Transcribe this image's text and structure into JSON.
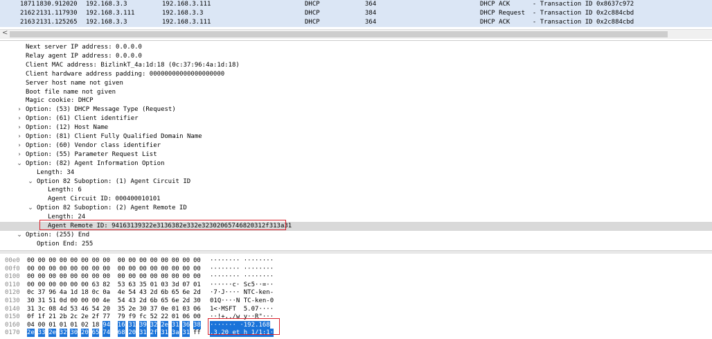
{
  "packets": [
    {
      "no": "1871",
      "time": "1830.912020",
      "src": "192.168.3.3",
      "dst": "192.168.3.111",
      "proto": "DHCP",
      "len": "364",
      "info": "DHCP ACK      - Transaction ID 0x8637c972"
    },
    {
      "no": "2162",
      "time": "2131.117930",
      "src": "192.168.3.111",
      "dst": "192.168.3.3",
      "proto": "DHCP",
      "len": "384",
      "info": "DHCP Request  - Transaction ID 0x2c884cbd"
    },
    {
      "no": "2163",
      "time": "2131.125265",
      "src": "192.168.3.3",
      "dst": "192.168.3.111",
      "proto": "DHCP",
      "len": "364",
      "info": "DHCP ACK      - Transaction ID 0x2c884cbd"
    }
  ],
  "scroll_left_arrow": "<",
  "details": [
    {
      "text": "Next server IP address: 0.0.0.0",
      "exp": ""
    },
    {
      "text": "Relay agent IP address: 0.0.0.0",
      "exp": ""
    },
    {
      "text": "Client MAC address: BizlinkT_4a:1d:18 (0c:37:96:4a:1d:18)",
      "exp": ""
    },
    {
      "text": "Client hardware address padding: 00000000000000000000",
      "exp": ""
    },
    {
      "text": "Server host name not given",
      "exp": ""
    },
    {
      "text": "Boot file name not given",
      "exp": ""
    },
    {
      "text": "Magic cookie: DHCP",
      "exp": ""
    },
    {
      "text": "Option: (53) DHCP Message Type (Request)",
      "exp": "›"
    },
    {
      "text": "Option: (61) Client identifier",
      "exp": "›"
    },
    {
      "text": "Option: (12) Host Name",
      "exp": "›"
    },
    {
      "text": "Option: (81) Client Fully Qualified Domain Name",
      "exp": "›"
    },
    {
      "text": "Option: (60) Vendor class identifier",
      "exp": "›"
    },
    {
      "text": "Option: (55) Parameter Request List",
      "exp": "›"
    },
    {
      "text": "Option: (82) Agent Information Option",
      "exp": "⌄"
    },
    {
      "text": "Length: 34",
      "exp": ""
    },
    {
      "text": "Option 82 Suboption: (1) Agent Circuit ID",
      "exp": "⌄"
    },
    {
      "text": "Length: 6",
      "exp": ""
    },
    {
      "text": "Agent Circuit ID: 000400010101",
      "exp": ""
    },
    {
      "text": "Option 82 Suboption: (2) Agent Remote ID",
      "exp": "⌄"
    },
    {
      "text": "Length: 24",
      "exp": ""
    },
    {
      "text": "Agent Remote ID: 94163139322e3136382e332e32302065746820312f313a31",
      "exp": ""
    },
    {
      "text": "Option: (255) End",
      "exp": "⌄"
    },
    {
      "text": "Option End: 255",
      "exp": ""
    }
  ],
  "hex": [
    {
      "off": "00e0",
      "bytes": [
        "00",
        "00",
        "00",
        "00",
        "00",
        "00",
        "00",
        "00",
        "00",
        "00",
        "00",
        "00",
        "00",
        "00",
        "00",
        "00"
      ],
      "ascii": "········ ········"
    },
    {
      "off": "00f0",
      "bytes": [
        "00",
        "00",
        "00",
        "00",
        "00",
        "00",
        "00",
        "00",
        "00",
        "00",
        "00",
        "00",
        "00",
        "00",
        "00",
        "00"
      ],
      "ascii": "········ ········"
    },
    {
      "off": "0100",
      "bytes": [
        "00",
        "00",
        "00",
        "00",
        "00",
        "00",
        "00",
        "00",
        "00",
        "00",
        "00",
        "00",
        "00",
        "00",
        "00",
        "00"
      ],
      "ascii": "········ ········"
    },
    {
      "off": "0110",
      "bytes": [
        "00",
        "00",
        "00",
        "00",
        "00",
        "00",
        "63",
        "82",
        "53",
        "63",
        "35",
        "01",
        "03",
        "3d",
        "07",
        "01"
      ],
      "ascii": "······c· Sc5··=··"
    },
    {
      "off": "0120",
      "bytes": [
        "0c",
        "37",
        "96",
        "4a",
        "1d",
        "18",
        "0c",
        "0a",
        "4e",
        "54",
        "43",
        "2d",
        "6b",
        "65",
        "6e",
        "2d"
      ],
      "ascii": "·7·J···· NTC-ken-"
    },
    {
      "off": "0130",
      "bytes": [
        "30",
        "31",
        "51",
        "0d",
        "00",
        "00",
        "00",
        "4e",
        "54",
        "43",
        "2d",
        "6b",
        "65",
        "6e",
        "2d",
        "30"
      ],
      "ascii": "01Q····N TC-ken-0"
    },
    {
      "off": "0140",
      "bytes": [
        "31",
        "3c",
        "08",
        "4d",
        "53",
        "46",
        "54",
        "20",
        "35",
        "2e",
        "30",
        "37",
        "0e",
        "01",
        "03",
        "06"
      ],
      "ascii": "1<·MSFT  5.07····"
    },
    {
      "off": "0150",
      "bytes": [
        "0f",
        "1f",
        "21",
        "2b",
        "2c",
        "2e",
        "2f",
        "77",
        "79",
        "f9",
        "fc",
        "52",
        "22",
        "01",
        "06",
        "00"
      ],
      "ascii": "··!+,./w y··R\"···"
    },
    {
      "off": "0160",
      "bytes": [
        "04",
        "00",
        "01",
        "01",
        "01",
        "02",
        "18",
        "94",
        "16",
        "31",
        "39",
        "32",
        "2e",
        "31",
        "36",
        "38"
      ],
      "ascii": "······· ·192.168"
    },
    {
      "off": "0170",
      "bytes": [
        "2e",
        "33",
        "2e",
        "32",
        "30",
        "20",
        "65",
        "74",
        "68",
        "20",
        "31",
        "2f",
        "31",
        "3a",
        "31",
        "ff"
      ],
      "ascii": ".3.20 et h 1/1:1·"
    }
  ]
}
